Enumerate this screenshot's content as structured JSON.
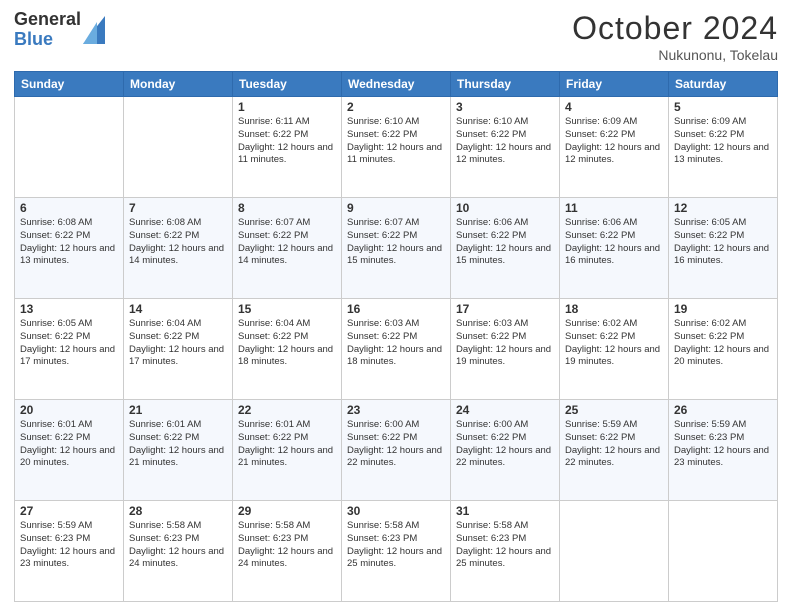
{
  "logo": {
    "line1": "General",
    "line2": "Blue"
  },
  "header": {
    "month": "October 2024",
    "location": "Nukunonu, Tokelau"
  },
  "days_of_week": [
    "Sunday",
    "Monday",
    "Tuesday",
    "Wednesday",
    "Thursday",
    "Friday",
    "Saturday"
  ],
  "weeks": [
    [
      {
        "day": "",
        "info": ""
      },
      {
        "day": "",
        "info": ""
      },
      {
        "day": "1",
        "info": "Sunrise: 6:11 AM\nSunset: 6:22 PM\nDaylight: 12 hours and 11 minutes."
      },
      {
        "day": "2",
        "info": "Sunrise: 6:10 AM\nSunset: 6:22 PM\nDaylight: 12 hours and 11 minutes."
      },
      {
        "day": "3",
        "info": "Sunrise: 6:10 AM\nSunset: 6:22 PM\nDaylight: 12 hours and 12 minutes."
      },
      {
        "day": "4",
        "info": "Sunrise: 6:09 AM\nSunset: 6:22 PM\nDaylight: 12 hours and 12 minutes."
      },
      {
        "day": "5",
        "info": "Sunrise: 6:09 AM\nSunset: 6:22 PM\nDaylight: 12 hours and 13 minutes."
      }
    ],
    [
      {
        "day": "6",
        "info": "Sunrise: 6:08 AM\nSunset: 6:22 PM\nDaylight: 12 hours and 13 minutes."
      },
      {
        "day": "7",
        "info": "Sunrise: 6:08 AM\nSunset: 6:22 PM\nDaylight: 12 hours and 14 minutes."
      },
      {
        "day": "8",
        "info": "Sunrise: 6:07 AM\nSunset: 6:22 PM\nDaylight: 12 hours and 14 minutes."
      },
      {
        "day": "9",
        "info": "Sunrise: 6:07 AM\nSunset: 6:22 PM\nDaylight: 12 hours and 15 minutes."
      },
      {
        "day": "10",
        "info": "Sunrise: 6:06 AM\nSunset: 6:22 PM\nDaylight: 12 hours and 15 minutes."
      },
      {
        "day": "11",
        "info": "Sunrise: 6:06 AM\nSunset: 6:22 PM\nDaylight: 12 hours and 16 minutes."
      },
      {
        "day": "12",
        "info": "Sunrise: 6:05 AM\nSunset: 6:22 PM\nDaylight: 12 hours and 16 minutes."
      }
    ],
    [
      {
        "day": "13",
        "info": "Sunrise: 6:05 AM\nSunset: 6:22 PM\nDaylight: 12 hours and 17 minutes."
      },
      {
        "day": "14",
        "info": "Sunrise: 6:04 AM\nSunset: 6:22 PM\nDaylight: 12 hours and 17 minutes."
      },
      {
        "day": "15",
        "info": "Sunrise: 6:04 AM\nSunset: 6:22 PM\nDaylight: 12 hours and 18 minutes."
      },
      {
        "day": "16",
        "info": "Sunrise: 6:03 AM\nSunset: 6:22 PM\nDaylight: 12 hours and 18 minutes."
      },
      {
        "day": "17",
        "info": "Sunrise: 6:03 AM\nSunset: 6:22 PM\nDaylight: 12 hours and 19 minutes."
      },
      {
        "day": "18",
        "info": "Sunrise: 6:02 AM\nSunset: 6:22 PM\nDaylight: 12 hours and 19 minutes."
      },
      {
        "day": "19",
        "info": "Sunrise: 6:02 AM\nSunset: 6:22 PM\nDaylight: 12 hours and 20 minutes."
      }
    ],
    [
      {
        "day": "20",
        "info": "Sunrise: 6:01 AM\nSunset: 6:22 PM\nDaylight: 12 hours and 20 minutes."
      },
      {
        "day": "21",
        "info": "Sunrise: 6:01 AM\nSunset: 6:22 PM\nDaylight: 12 hours and 21 minutes."
      },
      {
        "day": "22",
        "info": "Sunrise: 6:01 AM\nSunset: 6:22 PM\nDaylight: 12 hours and 21 minutes."
      },
      {
        "day": "23",
        "info": "Sunrise: 6:00 AM\nSunset: 6:22 PM\nDaylight: 12 hours and 22 minutes."
      },
      {
        "day": "24",
        "info": "Sunrise: 6:00 AM\nSunset: 6:22 PM\nDaylight: 12 hours and 22 minutes."
      },
      {
        "day": "25",
        "info": "Sunrise: 5:59 AM\nSunset: 6:22 PM\nDaylight: 12 hours and 22 minutes."
      },
      {
        "day": "26",
        "info": "Sunrise: 5:59 AM\nSunset: 6:23 PM\nDaylight: 12 hours and 23 minutes."
      }
    ],
    [
      {
        "day": "27",
        "info": "Sunrise: 5:59 AM\nSunset: 6:23 PM\nDaylight: 12 hours and 23 minutes."
      },
      {
        "day": "28",
        "info": "Sunrise: 5:58 AM\nSunset: 6:23 PM\nDaylight: 12 hours and 24 minutes."
      },
      {
        "day": "29",
        "info": "Sunrise: 5:58 AM\nSunset: 6:23 PM\nDaylight: 12 hours and 24 minutes."
      },
      {
        "day": "30",
        "info": "Sunrise: 5:58 AM\nSunset: 6:23 PM\nDaylight: 12 hours and 25 minutes."
      },
      {
        "day": "31",
        "info": "Sunrise: 5:58 AM\nSunset: 6:23 PM\nDaylight: 12 hours and 25 minutes."
      },
      {
        "day": "",
        "info": ""
      },
      {
        "day": "",
        "info": ""
      }
    ]
  ]
}
